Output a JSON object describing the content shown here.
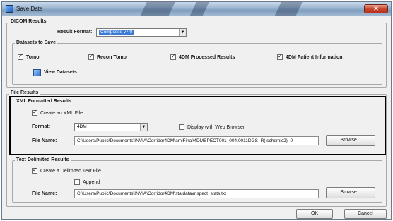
{
  "window": {
    "title": "Save Data",
    "close_glyph": "✕"
  },
  "dicom": {
    "group_title": "DICOM Results",
    "result_format_label": "Result Format:",
    "result_format_value": "Composite v7.0",
    "datasets_title": "Datasets to Save",
    "checkboxes": [
      {
        "label": "Tomo",
        "checked": true
      },
      {
        "label": "Recon Tomo",
        "checked": true
      },
      {
        "label": "4DM Processed Results",
        "checked": true
      },
      {
        "label": "4DM Patient Information",
        "checked": true
      }
    ],
    "view_datasets_label": "View Datasets",
    "view_icon": "datasets-icon"
  },
  "file_results": {
    "group_title": "File Results",
    "xml": {
      "group_title": "XML Formatted Results",
      "create_label": "Create an XML File",
      "create_checked": true,
      "format_label": "Format:",
      "format_value": "4DM",
      "web_browser_label": "Display with Web Browser",
      "web_browser_checked": false,
      "file_name_label": "File Name:",
      "file_name_value": "C:\\Users\\Public\\Documents\\INVIA\\Corridor4DM\\amlFinal\\4DMSPECT001_004.0011DGS_R(Ischemic2)_0",
      "browse_label": "Browse..."
    },
    "text": {
      "group_title": "Text Delimited Results",
      "create_label": "Create a Delimited Text File",
      "create_checked": true,
      "append_label": "Append",
      "append_checked": false,
      "file_name_label": "File Name:",
      "file_name_value": "C:\\Users\\Public\\Documents\\INVIA\\Corridor4DM\\statdata\\mspect_stats.txt",
      "browse_label": "Browse..."
    }
  },
  "buttons": {
    "ok": "OK",
    "cancel": "Cancel"
  },
  "colors": {
    "accent": "#3a7bd5",
    "title_close": "#c7432a"
  }
}
